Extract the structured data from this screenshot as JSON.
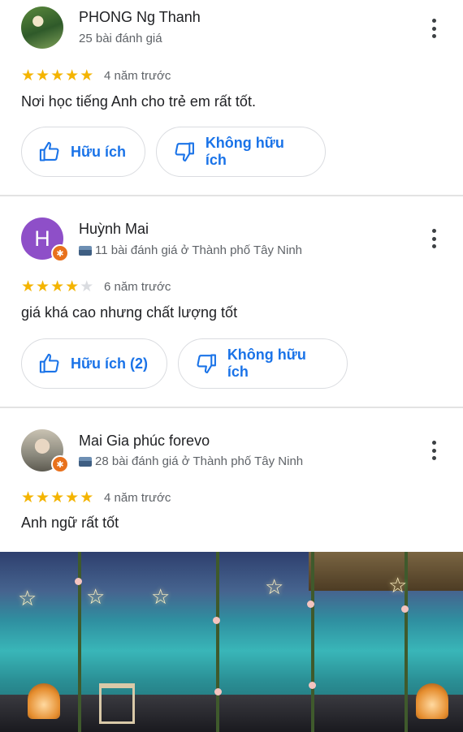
{
  "reviews": [
    {
      "name": "PHONG Ng Thanh",
      "meta": "25 bài đánh giá",
      "rating": 5,
      "time": "4 năm trước",
      "text": "Nơi học tiếng Anh cho trẻ em rất tốt.",
      "helpful_label": "Hữu ích",
      "not_helpful_label": "Không hữu ích"
    },
    {
      "name": "Huỳnh Mai",
      "avatar_letter": "H",
      "meta": "11 bài đánh giá ở Thành phố Tây Ninh",
      "rating": 4,
      "time": "6 năm trước",
      "text": "giá khá cao nhưng chất lượng tốt",
      "helpful_label": "Hữu ích (2)",
      "not_helpful_label": "Không hữu ích"
    },
    {
      "name": "Mai Gia phúc forevo",
      "meta": "28 bài đánh giá ở Thành phố Tây Ninh",
      "rating": 5,
      "time": "4 năm trước",
      "text": "Anh ngữ rất tốt"
    }
  ],
  "colors": {
    "accent": "#1a73e8",
    "star": "#f4b400",
    "local_guide_badge": "#e8711c",
    "avatar_purple": "#8e4fc8"
  },
  "icons": [
    "more-vert-icon",
    "thumb-up-icon",
    "thumb-down-icon",
    "star-icon",
    "local-guide-badge-icon",
    "city-icon"
  ]
}
